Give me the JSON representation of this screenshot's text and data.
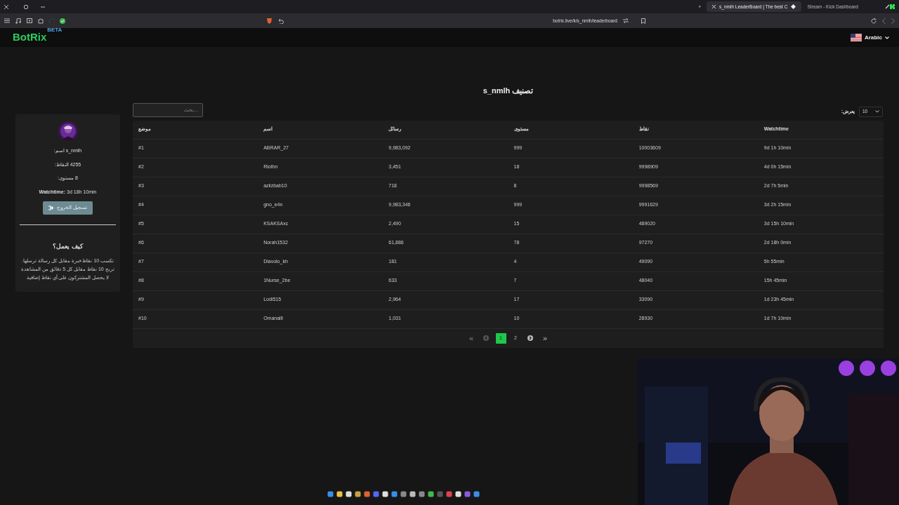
{
  "browser": {
    "tabs": [
      {
        "label": "s_nmlh LeaderBoard | The best C",
        "selected": true
      },
      {
        "label": "Stream - Kick Dashboard",
        "selected": false
      }
    ],
    "new_tab": "+",
    "address": "botrix.live/k/s_nmlh/leaderboard"
  },
  "navbar": {
    "brand": "BotRix",
    "badge": "BETA",
    "language": "Arabic"
  },
  "profile": {
    "stats": [
      {
        "label": "اسم:",
        "value": "s_nmlh",
        "bold": false
      },
      {
        "label": "النقاط:",
        "value": "4255",
        "bold": false
      },
      {
        "label": "مستوى:",
        "value": "8",
        "bold": false
      },
      {
        "label": "Watchtime:",
        "value": "3d 18h 10min",
        "bold": true
      }
    ],
    "logout": "تسجيل الخروج",
    "how_title": "كيف يعمل؟",
    "how_lines": [
      "تكسب 10 نقاط خبرة مقابل كل رسالة ترسلها.",
      "تربح 10 نقاط مقابل كل 5 دقائق من المشاهدة",
      "لا يحصل المشتركون على أي نقاط إضافية"
    ]
  },
  "leaderboard": {
    "title": "تصنيف s_nmlh",
    "search": {
      "placeholder": "...بحث"
    },
    "show_label": "يعرض:",
    "page_size": "10",
    "columns": [
      "موضع",
      "اسم",
      "رسائل",
      "مستوى",
      "نقاط",
      "Watchtime"
    ],
    "rows": [
      [
        "#1",
        "ABRAR_27",
        "9,983,092",
        "999",
        "10003609",
        "9d 1h 10min"
      ],
      [
        "#2",
        "Riothn",
        "3,451",
        "18",
        "9998909",
        "4d 0h 15min"
      ],
      [
        "#3",
        "aziizbab10",
        "718",
        "8",
        "9998569",
        "2d 7h 5min"
      ],
      [
        "#4",
        "gno_e4n",
        "9,983,346",
        "999",
        "9991629",
        "3d 2h 15min"
      ],
      [
        "#5",
        "KSAKSAxc",
        "2,490",
        "15",
        "489020",
        "3d 15h 10min"
      ],
      [
        "#6",
        "Norah1532",
        "61,886",
        "78",
        "97270",
        "2d 18h 0min"
      ],
      [
        "#7",
        "Diavolo_kh",
        "181",
        "4",
        "49090",
        "5h 55min"
      ],
      [
        "#8",
        "1Nurse_2be",
        "633",
        "7",
        "48040",
        "15h 45min"
      ],
      [
        "#9",
        "Lodi515",
        "2,964",
        "17",
        "33090",
        "1d 23h 45min"
      ],
      [
        "#10",
        "Omanalll",
        "1,031",
        "10",
        "28930",
        "1d 7h 10min"
      ]
    ],
    "pagination": [
      {
        "kind": "first",
        "label": "«",
        "disabled": true,
        "selected": false
      },
      {
        "kind": "prev",
        "disabled": true,
        "selected": false
      },
      {
        "kind": "page",
        "label": "1",
        "disabled": false,
        "selected": true
      },
      {
        "kind": "page",
        "label": "2",
        "disabled": false,
        "selected": false
      },
      {
        "kind": "next",
        "disabled": false,
        "selected": false
      },
      {
        "kind": "last",
        "label": "»",
        "disabled": false,
        "selected": false
      }
    ]
  }
}
